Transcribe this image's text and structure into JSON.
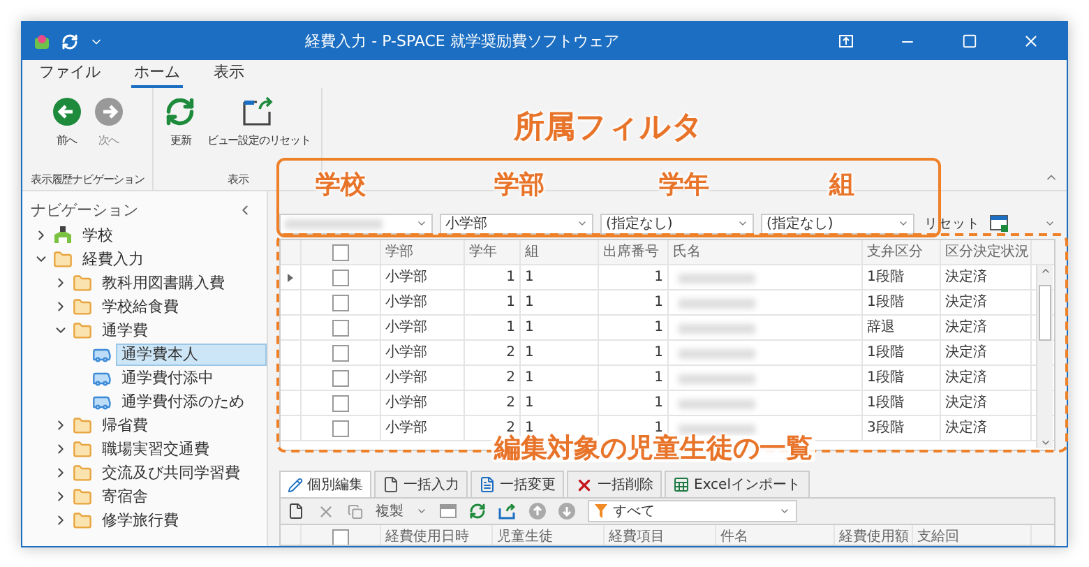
{
  "window": {
    "title": "経費入力 - P-SPACE 就学奨励費ソフトウェア"
  },
  "ribbon": {
    "tabs": [
      {
        "label": "ファイル",
        "selected": false
      },
      {
        "label": "ホーム",
        "selected": true
      },
      {
        "label": "表示",
        "selected": false
      }
    ],
    "groups": [
      {
        "label": "表示履歴ナビゲーション",
        "buttons": [
          {
            "label": "前へ",
            "kind": "back",
            "disabled": false
          },
          {
            "label": "次へ",
            "kind": "forward",
            "disabled": true
          }
        ]
      },
      {
        "label": "表示",
        "buttons": [
          {
            "label": "更新",
            "kind": "refresh",
            "disabled": false
          },
          {
            "label": "ビュー設定のリセット",
            "kind": "reset-view",
            "disabled": false
          }
        ]
      }
    ]
  },
  "navigation": {
    "title": "ナビゲーション",
    "items": [
      {
        "label": "学校",
        "kind": "school",
        "expanded": false,
        "selected": false
      },
      {
        "label": "経費入力",
        "kind": "folder",
        "expanded": true,
        "selected": false,
        "children": [
          {
            "label": "教科用図書購入費",
            "kind": "folder",
            "expanded": false,
            "selected": false
          },
          {
            "label": "学校給食費",
            "kind": "folder",
            "expanded": false,
            "selected": false
          },
          {
            "label": "通学費",
            "kind": "folder",
            "expanded": true,
            "selected": false,
            "children": [
              {
                "label": "通学費本人",
                "kind": "bus",
                "selected": true
              },
              {
                "label": "通学費付添中",
                "kind": "bus",
                "selected": false
              },
              {
                "label": "通学費付添のため",
                "kind": "bus",
                "selected": false
              }
            ]
          },
          {
            "label": "帰省費",
            "kind": "folder",
            "expanded": false,
            "selected": false
          },
          {
            "label": "職場実習交通費",
            "kind": "folder",
            "expanded": false,
            "selected": false
          },
          {
            "label": "交流及び共同学習費",
            "kind": "folder",
            "expanded": false,
            "selected": false
          },
          {
            "label": "寄宿舎",
            "kind": "folder",
            "expanded": false,
            "selected": false
          },
          {
            "label": "修学旅行費",
            "kind": "folder",
            "expanded": false,
            "selected": false
          }
        ]
      }
    ]
  },
  "filters": [
    {
      "kind": "redacted"
    },
    {
      "kind": "text",
      "value": "小学部"
    },
    {
      "kind": "text",
      "value": "(指定なし)"
    },
    {
      "kind": "text",
      "value": "(指定なし)"
    }
  ],
  "reset_button": "リセット",
  "grid": {
    "header_checked": false,
    "columns": [
      {
        "label": "学部",
        "kind": "text"
      },
      {
        "label": "学年",
        "kind": "number"
      },
      {
        "label": "組",
        "kind": "text"
      },
      {
        "label": "出席番号",
        "kind": "number"
      },
      {
        "label": "氏名",
        "kind": "redacted"
      },
      {
        "label": "支弁区分",
        "kind": "text"
      },
      {
        "label": "区分決定状況",
        "kind": "text"
      }
    ],
    "rows": [
      {
        "current": true,
        "checked": false,
        "cells": [
          "小学部",
          "1",
          "1",
          "1",
          "",
          "1段階",
          "決定済"
        ]
      },
      {
        "current": false,
        "checked": false,
        "cells": [
          "小学部",
          "1",
          "1",
          "1",
          "",
          "1段階",
          "決定済"
        ]
      },
      {
        "current": false,
        "checked": false,
        "cells": [
          "小学部",
          "1",
          "1",
          "1",
          "",
          "辞退",
          "決定済"
        ]
      },
      {
        "current": false,
        "checked": false,
        "cells": [
          "小学部",
          "2",
          "1",
          "1",
          "",
          "1段階",
          "決定済"
        ]
      },
      {
        "current": false,
        "checked": false,
        "cells": [
          "小学部",
          "2",
          "1",
          "1",
          "",
          "1段階",
          "決定済"
        ]
      },
      {
        "current": false,
        "checked": false,
        "cells": [
          "小学部",
          "2",
          "1",
          "1",
          "",
          "1段階",
          "決定済"
        ]
      },
      {
        "current": false,
        "checked": false,
        "cells": [
          "小学部",
          "2",
          "1",
          "1",
          "",
          "3段階",
          "決定済"
        ]
      }
    ]
  },
  "detail_tabs": [
    {
      "label": "個別編集",
      "kind": "edit",
      "selected": true
    },
    {
      "label": "一括入力",
      "kind": "page",
      "selected": false
    },
    {
      "label": "一括変更",
      "kind": "page-edit",
      "selected": false
    },
    {
      "label": "一括削除",
      "kind": "delete",
      "selected": false
    },
    {
      "label": "Excelインポート",
      "kind": "excel",
      "selected": false
    }
  ],
  "detail_toolbar": {
    "copy_label": "複製",
    "filter": "すべて"
  },
  "detail_grid": {
    "header_checked": false,
    "columns": [
      "経費使用日時",
      "児童生徒",
      "経費項目",
      "件名",
      "経費使用額",
      "支給回"
    ]
  },
  "annotations": [
    {
      "kind": "filter",
      "title": "所属フィルタ",
      "labels": [
        "学校",
        "学部",
        "学年",
        "組"
      ]
    },
    {
      "kind": "list",
      "title": "編集対象の児童生徒の一覧"
    }
  ]
}
